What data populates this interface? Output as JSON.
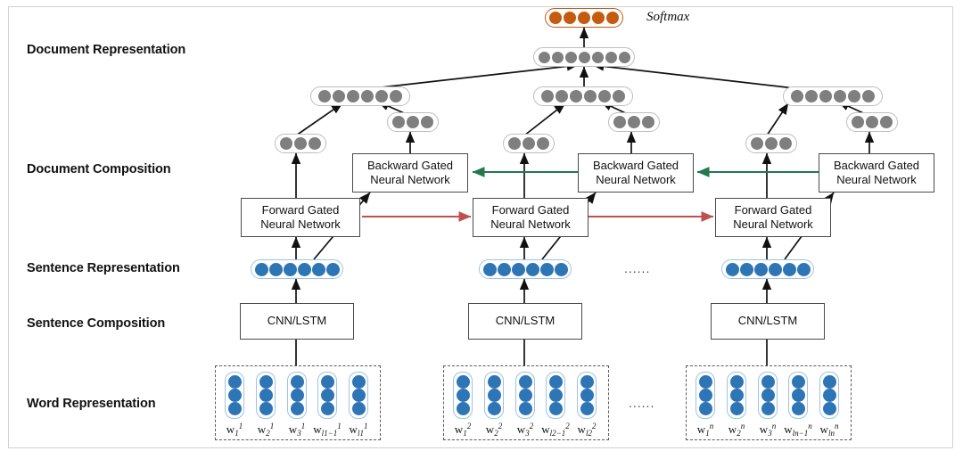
{
  "figure": {
    "title": "Hierarchical neural document model",
    "background": "#ffffff",
    "frame_color": "#d2d2d2"
  },
  "colors": {
    "blue_dot": "#2e75b6",
    "blue_outline": "#9dc3e6",
    "gray_dot": "#7f7f7f",
    "gray_outline": "#bdbdbd",
    "orange": "#c55a11",
    "forward_arrow": "#c0504d",
    "backward_arrow": "#1f7a4d",
    "box_border": "#4a4a4a",
    "text": "#111111"
  },
  "row_labels": [
    {
      "id": "document-representation",
      "text": "Document Representation"
    },
    {
      "id": "document-composition",
      "text": "Document Composition"
    },
    {
      "id": "sentence-representation",
      "text": "Sentence Representation"
    },
    {
      "id": "sentence-composition",
      "text": "Sentence Composition"
    },
    {
      "id": "word-representation",
      "text": "Word Representation"
    }
  ],
  "softmax": {
    "label": "Softmax",
    "dot_count": 5,
    "color": "#c55a11"
  },
  "document_vector": {
    "dot_count": 7
  },
  "sentence_level_vectors": [
    {
      "id": "sent-vec-1",
      "dot_count": 6
    },
    {
      "id": "sent-vec-2",
      "dot_count": 6
    },
    {
      "id": "sent-vec-3",
      "dot_count": 6
    }
  ],
  "hidden_state_vectors": [
    {
      "id": "forward-hidden-1",
      "dot_count": 3,
      "direction": "forward"
    },
    {
      "id": "backward-hidden-1",
      "dot_count": 3,
      "direction": "backward"
    },
    {
      "id": "forward-hidden-2",
      "dot_count": 3,
      "direction": "forward"
    },
    {
      "id": "backward-hidden-2",
      "dot_count": 3,
      "direction": "backward"
    },
    {
      "id": "forward-hidden-3",
      "dot_count": 3,
      "direction": "forward"
    },
    {
      "id": "backward-hidden-3",
      "dot_count": 3,
      "direction": "backward"
    }
  ],
  "gated_networks": {
    "forward_label": "Forward Gated\nNeural Network",
    "forward_line1": "Forward Gated",
    "forward_line2": "Neural Network",
    "backward_line1": "Backward Gated",
    "backward_line2": "Neural Network",
    "forward_boxes": [
      "forward-gnn-1",
      "forward-gnn-2",
      "forward-gnn-3"
    ],
    "backward_boxes": [
      "backward-gnn-1",
      "backward-gnn-2",
      "backward-gnn-3"
    ]
  },
  "sentence_composition": {
    "label": "CNN/LSTM",
    "boxes": [
      "cnn-lstm-1",
      "cnn-lstm-2",
      "cnn-lstm-3"
    ]
  },
  "sentence_representations": [
    {
      "id": "sentence-rep-1",
      "dot_count": 6
    },
    {
      "id": "sentence-rep-2",
      "dot_count": 6
    },
    {
      "id": "sentence-rep-3",
      "dot_count": 6
    }
  ],
  "ellipses": {
    "sentence_row": "......",
    "word_row": "......"
  },
  "word_groups": [
    {
      "id": "word-group-1",
      "sentence_index": "1",
      "dots_per_word": 3,
      "words": [
        {
          "base": "w",
          "sub": "1",
          "sup": "1"
        },
        {
          "base": "w",
          "sub": "2",
          "sup": "1"
        },
        {
          "base": "w",
          "sub": "3",
          "sup": "1"
        },
        {
          "base": "w",
          "sub": "l1−1",
          "sup": "1"
        },
        {
          "base": "w",
          "sub": "l1",
          "sup": "1"
        }
      ]
    },
    {
      "id": "word-group-2",
      "sentence_index": "2",
      "dots_per_word": 3,
      "words": [
        {
          "base": "w",
          "sub": "1",
          "sup": "2"
        },
        {
          "base": "w",
          "sub": "2",
          "sup": "2"
        },
        {
          "base": "w",
          "sub": "3",
          "sup": "2"
        },
        {
          "base": "w",
          "sub": "l2−1",
          "sup": "2"
        },
        {
          "base": "w",
          "sub": "l2",
          "sup": "2"
        }
      ]
    },
    {
      "id": "word-group-3",
      "sentence_index": "n",
      "dots_per_word": 3,
      "words": [
        {
          "base": "w",
          "sub": "1",
          "sup": "n"
        },
        {
          "base": "w",
          "sub": "2",
          "sup": "n"
        },
        {
          "base": "w",
          "sub": "3",
          "sup": "n"
        },
        {
          "base": "w",
          "sub": "ln−1",
          "sup": "n"
        },
        {
          "base": "w",
          "sub": "ln",
          "sup": "n"
        }
      ]
    }
  ]
}
